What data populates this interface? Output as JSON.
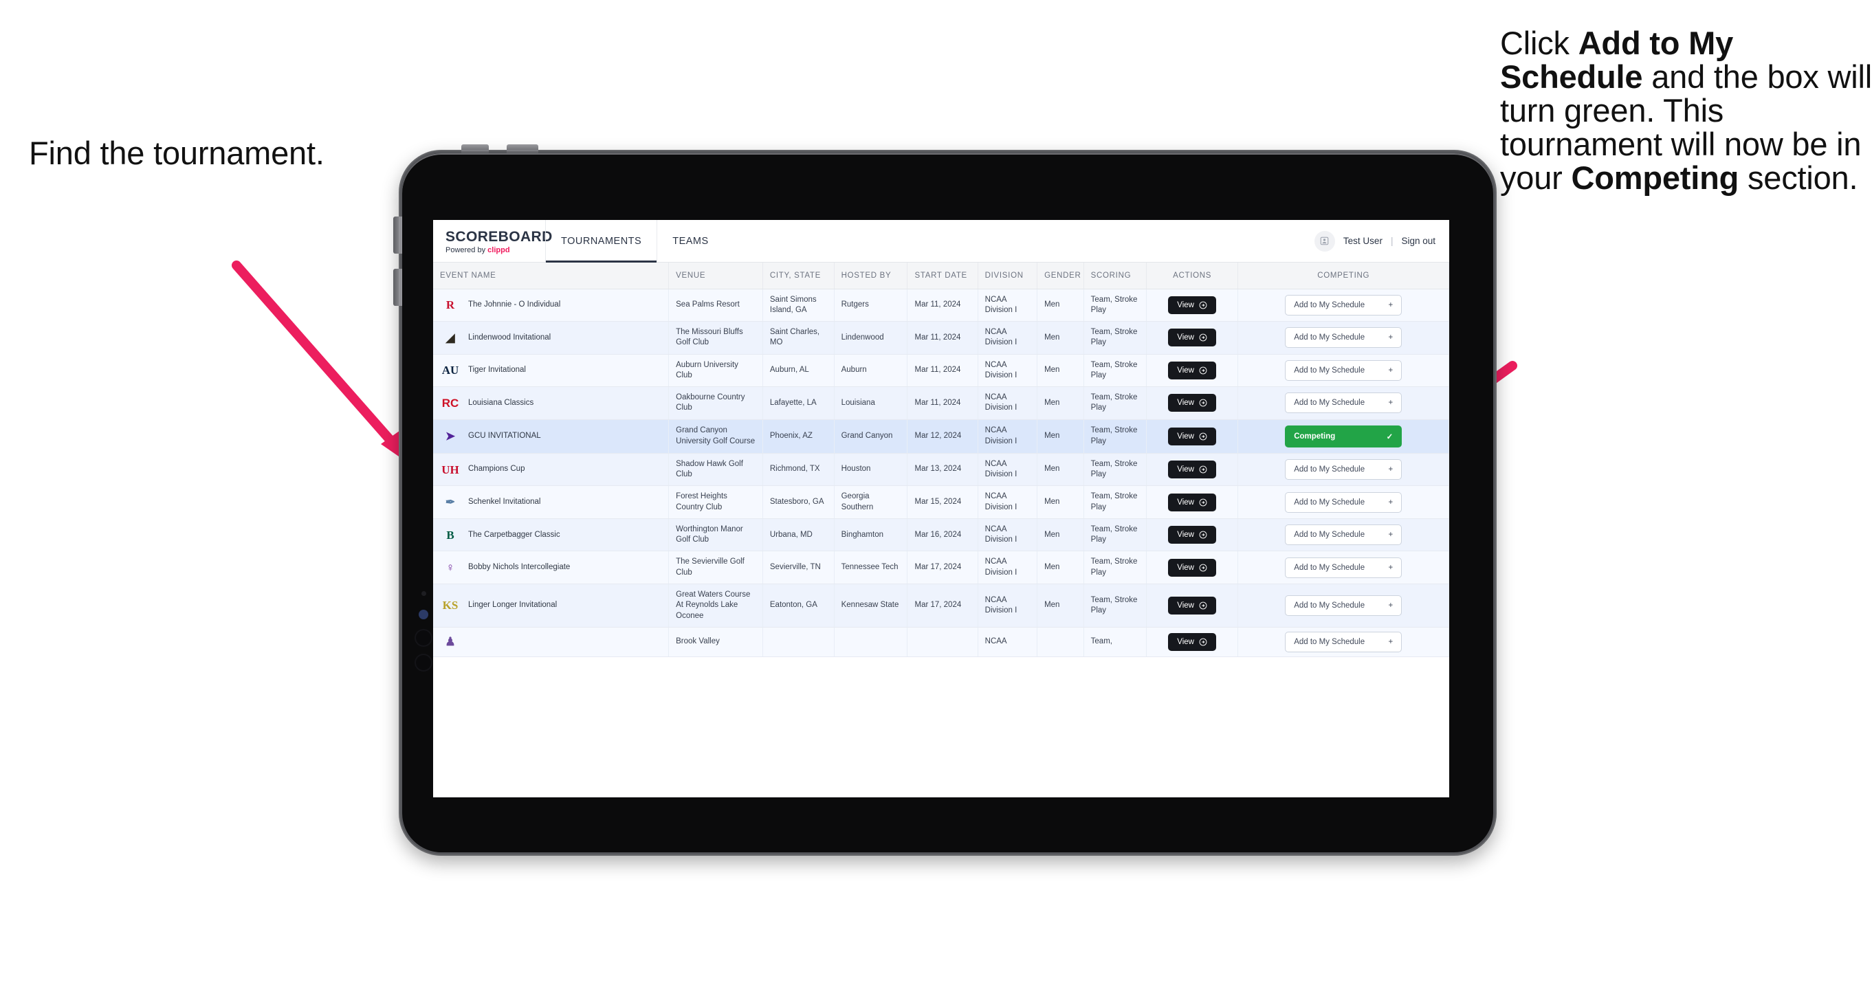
{
  "annotations": {
    "left": "Find the tournament.",
    "right_parts": [
      {
        "t": "Click ",
        "b": false
      },
      {
        "t": "Add to My Schedule",
        "b": true
      },
      {
        "t": " and the box will turn green. This tournament will now be in your ",
        "b": false
      },
      {
        "t": "Competing",
        "b": true
      },
      {
        "t": " section.",
        "b": false
      }
    ],
    "arrow_color": "#ec1e5e"
  },
  "app": {
    "brand": {
      "title": "SCOREBOARD",
      "powered_prefix": "Powered by ",
      "powered_brand": "clippd",
      "brand_color": "#2b3445",
      "clippd_color": "#f0195c"
    },
    "nav": [
      {
        "label": "TOURNAMENTS",
        "active": true
      },
      {
        "label": "TEAMS",
        "active": false
      }
    ],
    "account": {
      "avatar_icon": "user-avatar-icon",
      "user": "Test User",
      "separator": "|",
      "signout": "Sign out"
    },
    "table": {
      "columns": [
        "EVENT NAME",
        "VENUE",
        "CITY, STATE",
        "HOSTED BY",
        "START DATE",
        "DIVISION",
        "GENDER",
        "SCORING",
        "ACTIONS",
        "COMPETING"
      ],
      "view_label": "View",
      "add_label": "Add to My Schedule",
      "add_icon": "plus-icon",
      "competing_label": "Competing",
      "competing_icon": "check-icon",
      "competing_color": "#22a447",
      "rows": [
        {
          "logo": "R",
          "logo_color": "#c8102e",
          "logo_font": "serif",
          "event": "The Johnnie - O Individual",
          "venue": "Sea Palms Resort",
          "city": "Saint Simons Island, GA",
          "host": "Rutgers",
          "date": "Mar 11, 2024",
          "division": "NCAA Division I",
          "gender": "Men",
          "scoring": "Team, Stroke Play",
          "competing": false
        },
        {
          "logo": "◢",
          "logo_color": "#2f2a20",
          "logo_font": "sans",
          "event": "Lindenwood Invitational",
          "venue": "The Missouri Bluffs Golf Club",
          "city": "Saint Charles, MO",
          "host": "Lindenwood",
          "date": "Mar 11, 2024",
          "division": "NCAA Division I",
          "gender": "Men",
          "scoring": "Team, Stroke Play",
          "competing": false
        },
        {
          "logo": "AU",
          "logo_color": "#0c2340",
          "logo_font": "serif",
          "event": "Tiger Invitational",
          "venue": "Auburn University Club",
          "city": "Auburn, AL",
          "host": "Auburn",
          "date": "Mar 11, 2024",
          "division": "NCAA Division I",
          "gender": "Men",
          "scoring": "Team, Stroke Play",
          "competing": false
        },
        {
          "logo": "RC",
          "logo_color": "#ce1126",
          "logo_font": "sans",
          "event": "Louisiana Classics",
          "venue": "Oakbourne Country Club",
          "city": "Lafayette, LA",
          "host": "Louisiana",
          "date": "Mar 11, 2024",
          "division": "NCAA Division I",
          "gender": "Men",
          "scoring": "Team, Stroke Play",
          "competing": false
        },
        {
          "logo": "➤",
          "logo_color": "#522398",
          "logo_font": "sans",
          "event": "GCU INVITATIONAL",
          "venue": "Grand Canyon University Golf Course",
          "city": "Phoenix, AZ",
          "host": "Grand Canyon",
          "date": "Mar 12, 2024",
          "division": "NCAA Division I",
          "gender": "Men",
          "scoring": "Team, Stroke Play",
          "competing": true
        },
        {
          "logo": "UH",
          "logo_color": "#c8102e",
          "logo_font": "serif",
          "event": "Champions Cup",
          "venue": "Shadow Hawk Golf Club",
          "city": "Richmond, TX",
          "host": "Houston",
          "date": "Mar 13, 2024",
          "division": "NCAA Division I",
          "gender": "Men",
          "scoring": "Team, Stroke Play",
          "competing": false
        },
        {
          "logo": "✒",
          "logo_color": "#5a7fa6",
          "logo_font": "sans",
          "event": "Schenkel Invitational",
          "venue": "Forest Heights Country Club",
          "city": "Statesboro, GA",
          "host": "Georgia Southern",
          "date": "Mar 15, 2024",
          "division": "NCAA Division I",
          "gender": "Men",
          "scoring": "Team, Stroke Play",
          "competing": false
        },
        {
          "logo": "B",
          "logo_color": "#005a43",
          "logo_font": "serif",
          "event": "The Carpetbagger Classic",
          "venue": "Worthington Manor Golf Club",
          "city": "Urbana, MD",
          "host": "Binghamton",
          "date": "Mar 16, 2024",
          "division": "NCAA Division I",
          "gender": "Men",
          "scoring": "Team, Stroke Play",
          "competing": false
        },
        {
          "logo": "♀",
          "logo_color": "#73299c",
          "logo_font": "sans",
          "event": "Bobby Nichols Intercollegiate",
          "venue": "The Sevierville Golf Club",
          "city": "Sevierville, TN",
          "host": "Tennessee Tech",
          "date": "Mar 17, 2024",
          "division": "NCAA Division I",
          "gender": "Men",
          "scoring": "Team, Stroke Play",
          "competing": false
        },
        {
          "logo": "KS",
          "logo_color": "#b8a22a",
          "logo_font": "serif",
          "event": "Linger Longer Invitational",
          "venue": "Great Waters Course At Reynolds Lake Oconee",
          "city": "Eatonton, GA",
          "host": "Kennesaw State",
          "date": "Mar 17, 2024",
          "division": "NCAA Division I",
          "gender": "Men",
          "scoring": "Team, Stroke Play",
          "competing": false
        },
        {
          "logo": "♟",
          "logo_color": "#6c4a9c",
          "logo_font": "sans",
          "event": "",
          "venue": "Brook Valley",
          "city": "",
          "host": "",
          "date": "",
          "division": "NCAA",
          "gender": "",
          "scoring": "Team,",
          "competing": false,
          "clipped": true
        }
      ]
    }
  },
  "device": {
    "frame_color": "#0b0b0c",
    "bezel_color": "#55565a",
    "buttons": [
      "volume-up-button",
      "volume-down-button",
      "side-button-1",
      "side-button-2"
    ]
  }
}
